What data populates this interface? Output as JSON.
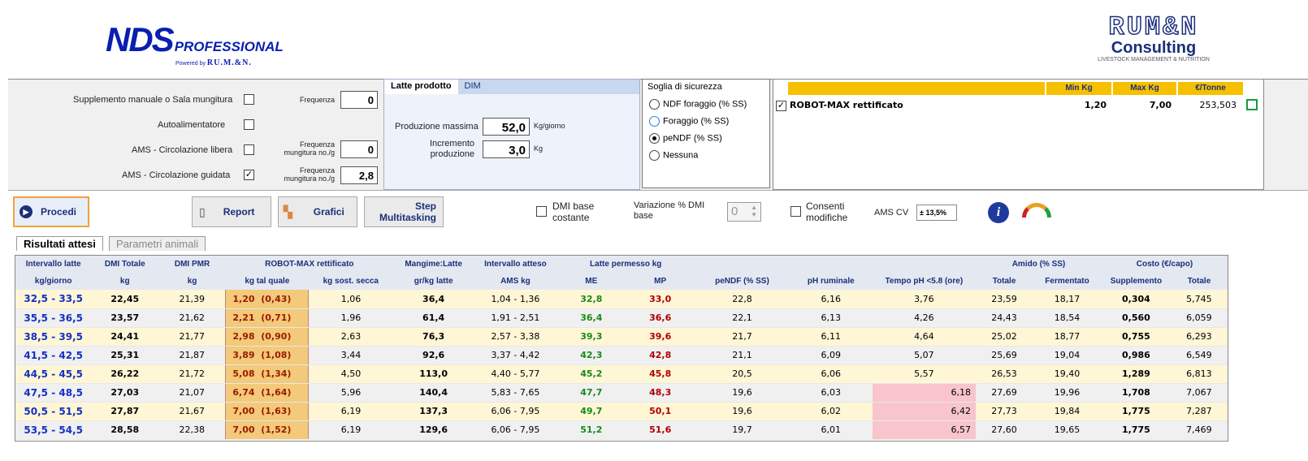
{
  "logos": {
    "nds_main": "NDS",
    "nds_pro": "PROFESSIONAL",
    "nds_powered": "Powered by",
    "nds_brand": "RU.M.&N.",
    "rum_main": "RUM&N",
    "rum_consulting": "Consulting",
    "rum_sub": "LIVESTOCK MANAGEMENT & NUTRITION"
  },
  "options": {
    "supplemento": "Supplemento manuale o Sala mungitura",
    "autoalim": "Autoalimentatore",
    "ams_libera": "AMS - Circolazione libera",
    "ams_guidata": "AMS - Circolazione guidata",
    "frequenza": "Frequenza",
    "freq_mung": "Frequenza mungitura no./g",
    "freq_val1": "0",
    "freq_val2": "0",
    "freq_val3": "2,8"
  },
  "latte": {
    "tab1": "Latte prodotto",
    "tab2": "DIM",
    "prod_max_label": "Produzione massima",
    "prod_max_val": "52,0",
    "prod_max_unit": "Kg/giorno",
    "incr_label": "Incremento produzione",
    "incr_val": "3,0",
    "incr_unit": "Kg"
  },
  "soglia": {
    "title": "Soglia di sicurezza",
    "opt1": "NDF foraggio (% SS)",
    "opt2": "Foraggio (% SS)",
    "opt3": "peNDF (% SS)",
    "opt4": "Nessuna"
  },
  "robot": {
    "col_min": "Min Kg",
    "col_max": "Max Kg",
    "col_eur": "€/Tonne",
    "name": "ROBOT-MAX rettificato",
    "min": "1,20",
    "max": "7,00",
    "eur": "253,503"
  },
  "toolbar": {
    "procedi": "Procedi",
    "report": "Report",
    "grafici": "Grafici",
    "step": "Step",
    "multitasking": "Multitasking",
    "dmi_base": "DMI base costante",
    "var_dmi": "Variazione % DMI base",
    "var_val": "0",
    "consenti": "Consenti modifiche",
    "ams_cv": "AMS CV",
    "ams_cv_val": "± 13,5%"
  },
  "tabs": {
    "t1": "Risultati attesi",
    "t2": "Parametri animali"
  },
  "table": {
    "group_headers": [
      "Intervallo latte",
      "DMI Totale",
      "DMI PMR",
      "ROBOT-MAX rettificato",
      "Mangime:Latte",
      "Intervallo atteso",
      "Latte permesso kg",
      "Amido (% SS)",
      "Costo (€/capo)"
    ],
    "sub_headers": [
      "kg/giorno",
      "kg",
      "kg",
      "kg tal quale",
      "kg sost. secca",
      "gr/kg latte",
      "AMS kg",
      "ME",
      "MP",
      "peNDF (% SS)",
      "pH ruminale",
      "Tempo pH <5.8 (ore)",
      "Totale",
      "Fermentato",
      "Supplemento",
      "Totale"
    ],
    "rows": [
      [
        "32,5 - 33,5",
        "22,45",
        "21,39",
        "1,20  (0,43)",
        "1,06",
        "36,4",
        "1,04 - 1,36",
        "32,8",
        "33,0",
        "22,8",
        "6,16",
        "3,76",
        "23,59",
        "18,17",
        "0,304",
        "5,745"
      ],
      [
        "35,5 - 36,5",
        "23,57",
        "21,62",
        "2,21  (0,71)",
        "1,96",
        "61,4",
        "1,91 - 2,51",
        "36,4",
        "36,6",
        "22,1",
        "6,13",
        "4,26",
        "24,43",
        "18,54",
        "0,560",
        "6,059"
      ],
      [
        "38,5 - 39,5",
        "24,41",
        "21,77",
        "2,98  (0,90)",
        "2,63",
        "76,3",
        "2,57 - 3,38",
        "39,3",
        "39,6",
        "21,7",
        "6,11",
        "4,64",
        "25,02",
        "18,77",
        "0,755",
        "6,293"
      ],
      [
        "41,5 - 42,5",
        "25,31",
        "21,87",
        "3,89  (1,08)",
        "3,44",
        "92,6",
        "3,37 - 4,42",
        "42,3",
        "42,8",
        "21,1",
        "6,09",
        "5,07",
        "25,69",
        "19,04",
        "0,986",
        "6,549"
      ],
      [
        "44,5 - 45,5",
        "26,22",
        "21,72",
        "5,08  (1,34)",
        "4,50",
        "113,0",
        "4,40 - 5,77",
        "45,2",
        "45,8",
        "20,5",
        "6,06",
        "5,57",
        "26,53",
        "19,40",
        "1,289",
        "6,813"
      ],
      [
        "47,5 - 48,5",
        "27,03",
        "21,07",
        "6,74  (1,64)",
        "5,96",
        "140,4",
        "5,83 - 7,65",
        "47,7",
        "48,3",
        "19,6",
        "6,03",
        "6,18",
        "27,69",
        "19,96",
        "1,708",
        "7,067"
      ],
      [
        "50,5 - 51,5",
        "27,87",
        "21,67",
        "7,00  (1,63)",
        "6,19",
        "137,3",
        "6,06 - 7,95",
        "49,7",
        "50,1",
        "19,6",
        "6,02",
        "6,42",
        "27,73",
        "19,84",
        "1,775",
        "7,287"
      ],
      [
        "53,5 - 54,5",
        "28,58",
        "22,38",
        "7,00  (1,52)",
        "6,19",
        "129,6",
        "6,06 - 7,95",
        "51,2",
        "51,6",
        "19,7",
        "6,01",
        "6,57",
        "27,60",
        "19,65",
        "1,775",
        "7,469"
      ]
    ]
  }
}
